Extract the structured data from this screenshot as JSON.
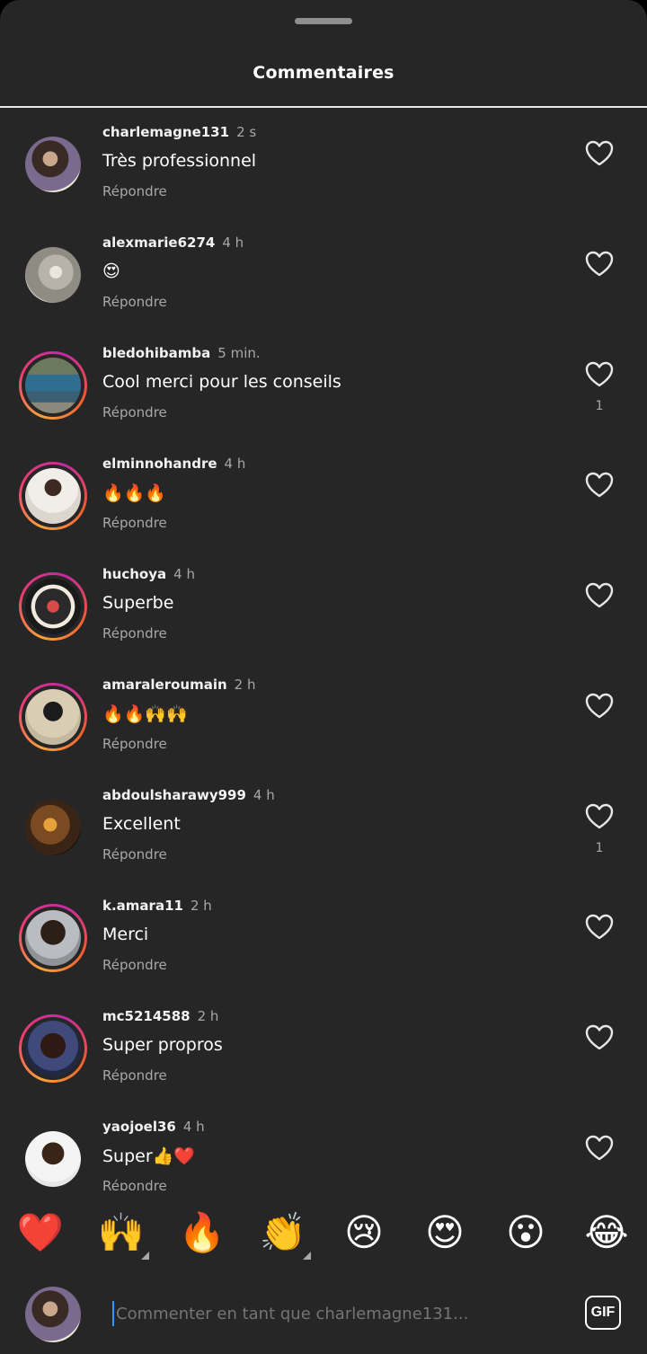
{
  "header": {
    "title": "Commentaires"
  },
  "comments": [
    {
      "user": "charlemagne131",
      "time": "2 s",
      "text": "Très professionnel",
      "reply": "Répondre",
      "likes": "",
      "ring": false
    },
    {
      "user": "alexmarie6274",
      "time": "4 h",
      "text": "😍",
      "reply": "Répondre",
      "likes": "",
      "ring": false
    },
    {
      "user": "bledohibamba",
      "time": "5 min.",
      "text": "Cool merci pour les conseils",
      "reply": "Répondre",
      "likes": "1",
      "ring": true
    },
    {
      "user": "elminnohandre",
      "time": "4 h",
      "text": "🔥🔥🔥",
      "reply": "Répondre",
      "likes": "",
      "ring": true
    },
    {
      "user": "huchoya",
      "time": "4 h",
      "text": "Superbe",
      "reply": "Répondre",
      "likes": "",
      "ring": true
    },
    {
      "user": "amaraleroumain",
      "time": "2 h",
      "text": "🔥🔥🙌🙌",
      "reply": "Répondre",
      "likes": "",
      "ring": true
    },
    {
      "user": "abdoulsharawy999",
      "time": "4 h",
      "text": "Excellent",
      "reply": "Répondre",
      "likes": "1",
      "ring": false
    },
    {
      "user": "k.amara11",
      "time": "2 h",
      "text": "Merci",
      "reply": "Répondre",
      "likes": "",
      "ring": true
    },
    {
      "user": "mc5214588",
      "time": "2 h",
      "text": "Super propros",
      "reply": "Répondre",
      "likes": "",
      "ring": true
    },
    {
      "user": "yaojoel36",
      "time": "4 h",
      "text": "Super👍❤️",
      "reply": "Répondre",
      "likes": "",
      "ring": false
    }
  ],
  "emoji_bar": [
    "❤️",
    "🙌",
    "🔥",
    "👏",
    "😢",
    "😍",
    "😮",
    "😂"
  ],
  "composer": {
    "placeholder": "Commenter en tant que charlemagne131...",
    "gif_label": "GIF"
  },
  "colors": {
    "background": "#262626",
    "secondary_text": "#a8a8a8",
    "ring_start": "#f9a23a",
    "ring_end": "#c32aa3"
  }
}
